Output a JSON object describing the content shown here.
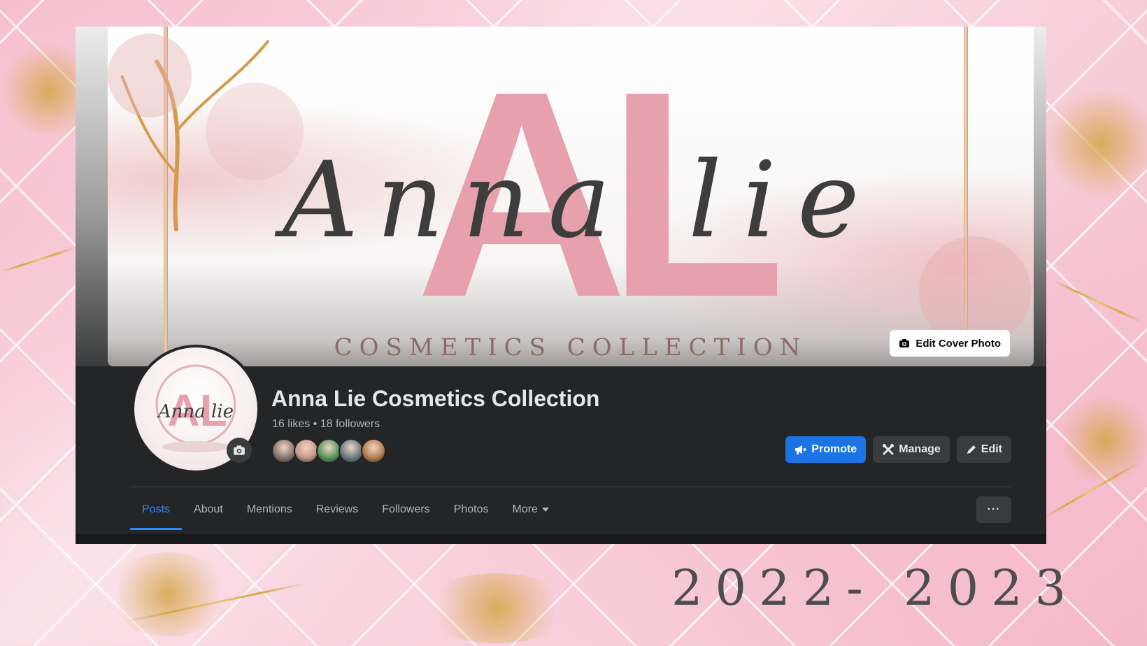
{
  "cover": {
    "edit_cover_label": "Edit Cover Photo",
    "logo_script_left": "Anna",
    "logo_script_right": "lie",
    "logo_monogram": "AL",
    "logo_tagline": "COSMETICS COLLECTION"
  },
  "profile": {
    "page_name": "Anna Lie Cosmetics Collection",
    "stats": "16 likes • 18 followers",
    "avatar_monogram": "AL",
    "avatar_script": "Anna lie"
  },
  "actions": {
    "promote_label": "Promote",
    "manage_label": "Manage",
    "edit_label": "Edit"
  },
  "tabs": [
    {
      "label": "Posts",
      "active": true
    },
    {
      "label": "About"
    },
    {
      "label": "Mentions"
    },
    {
      "label": "Reviews"
    },
    {
      "label": "Followers"
    },
    {
      "label": "Photos"
    },
    {
      "label": "More"
    }
  ],
  "more_options_label": "···",
  "caption": {
    "years": "2022- 2023"
  },
  "colors": {
    "accent": "#1b74e4",
    "active_tab": "#2d88ff",
    "logo_pink": "#e7a0ae",
    "script_gray": "#3d3d3d"
  },
  "follower_faces": [
    "#8a7a72",
    "#c79a8c",
    "#5b9a5e",
    "#6d7f86",
    "#b5824f"
  ]
}
